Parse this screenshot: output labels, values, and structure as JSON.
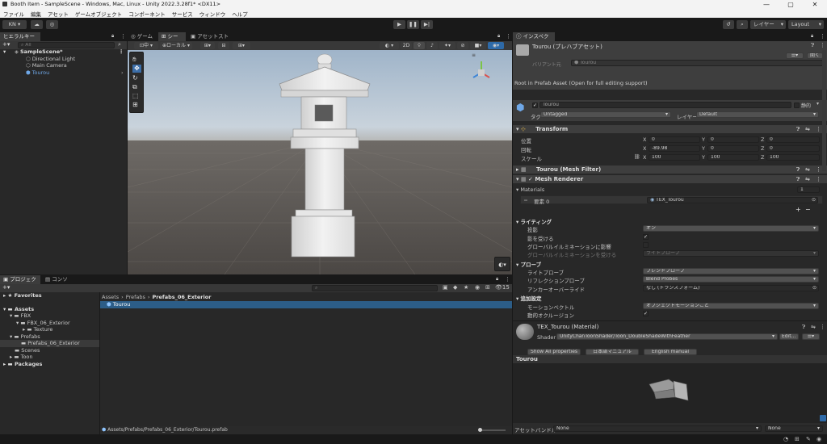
{
  "window": {
    "title": "Booth Item - SampleScene - Windows, Mac, Linux - Unity 2022.3.28f1* <DX11>"
  },
  "menu": [
    "ファイル",
    "編集",
    "アセット",
    "ゲームオブジェクト",
    "コンポーネント",
    "サービス",
    "ウィンドウ",
    "ヘルプ"
  ],
  "toolbar": {
    "account": "KN",
    "layers": "レイヤー",
    "layout": "Layout"
  },
  "hierarchy": {
    "tab": "ヒエラルキー",
    "search_placeholder": "All",
    "scene": "SampleScene*",
    "items": [
      "Directional Light",
      "Main Camera",
      "Tourou"
    ]
  },
  "scene_view": {
    "tabs": [
      "ゲーム",
      "シーン",
      "アセットストア"
    ],
    "mode_2d": "2D",
    "rect_tool": "ローカル"
  },
  "project": {
    "tabs": [
      "プロジェクト",
      "コンソール"
    ],
    "search_placeholder": "",
    "count": "15",
    "tree": {
      "favorites": "Favorites",
      "assets": "Assets",
      "fbx": "FBX",
      "fbx_exterior": "FBX_06_Exterior",
      "texture": "Texture",
      "prefabs": "Prefabs",
      "prefabs_exterior": "Prefabs_06_Exterior",
      "scenes": "Scenes",
      "toon": "Toon",
      "packages": "Packages"
    },
    "breadcrumb": [
      "Assets",
      "Prefabs",
      "Prefabs_06_Exterior"
    ],
    "selected_asset": "Tourou",
    "status_path": "Assets/Prefabs/Prefabs_06_Exterior/Tourou.prefab"
  },
  "inspector": {
    "tab": "インスペクター",
    "asset_title": "Tourou (プレハブアセット)",
    "open_button": "開く",
    "variant_label": "バリアント元",
    "variant_value": "Tourou",
    "root_note": "Root in Prefab Asset (Open for full editing support)",
    "object_name": "Tourou",
    "static_label": "静的",
    "tag_label": "タグ",
    "tag_value": "Untagged",
    "layer_label": "レイヤー",
    "layer_value": "Default",
    "transform": {
      "title": "Transform",
      "position_label": "位置",
      "rotation_label": "回転",
      "scale_label": "スケール",
      "position": [
        "0",
        "0",
        "0"
      ],
      "rotation": [
        "-89.98",
        "0",
        "0"
      ],
      "scale": [
        "100",
        "100",
        "100"
      ]
    },
    "mesh_filter": "Tourou (Mesh Filter)",
    "mesh_renderer": {
      "title": "Mesh Renderer",
      "materials_label": "Materials",
      "materials_count": "1",
      "element_label": "要素 0",
      "element_value": "TEX_Tourou"
    },
    "lighting": {
      "title": "ライティング",
      "cast_shadows_label": "投影",
      "cast_shadows_value": "オン",
      "receive_shadows_label": "影を受ける",
      "gi_contrib_label": "グローバルイルミネーションに影響",
      "gi_receive_label": "グローバルイルミネーションを受ける",
      "gi_receive_value": "ライトプローブ"
    },
    "probes": {
      "title": "プローブ",
      "light_probes_label": "ライトプローブ",
      "light_probes_value": "ブレンドプローブ",
      "reflection_label": "リフレクションプローブ",
      "reflection_value": "Blend Probes",
      "anchor_label": "アンカーオーバーライド",
      "anchor_value": "なし (トランスフォーム)"
    },
    "additional": {
      "title": "追加設定",
      "motion_label": "モーションベクトル",
      "motion_value": "オブジェクトモーションごと",
      "occlusion_label": "動的オクルージョン"
    },
    "material": {
      "title": "TEX_Tourou (Material)",
      "shader_label": "Shader",
      "shader_value": "UnityChanToonShader/Toon_DoubleShadeWithFeather",
      "edit_button": "Edit...",
      "buttons": [
        "Show All properties",
        "日本語マニュアル",
        "English manual"
      ]
    },
    "preview_title": "Tourou",
    "asset_bundle_label": "アセットバンドル",
    "asset_bundle_value": "None",
    "asset_bundle_variant": "None"
  }
}
